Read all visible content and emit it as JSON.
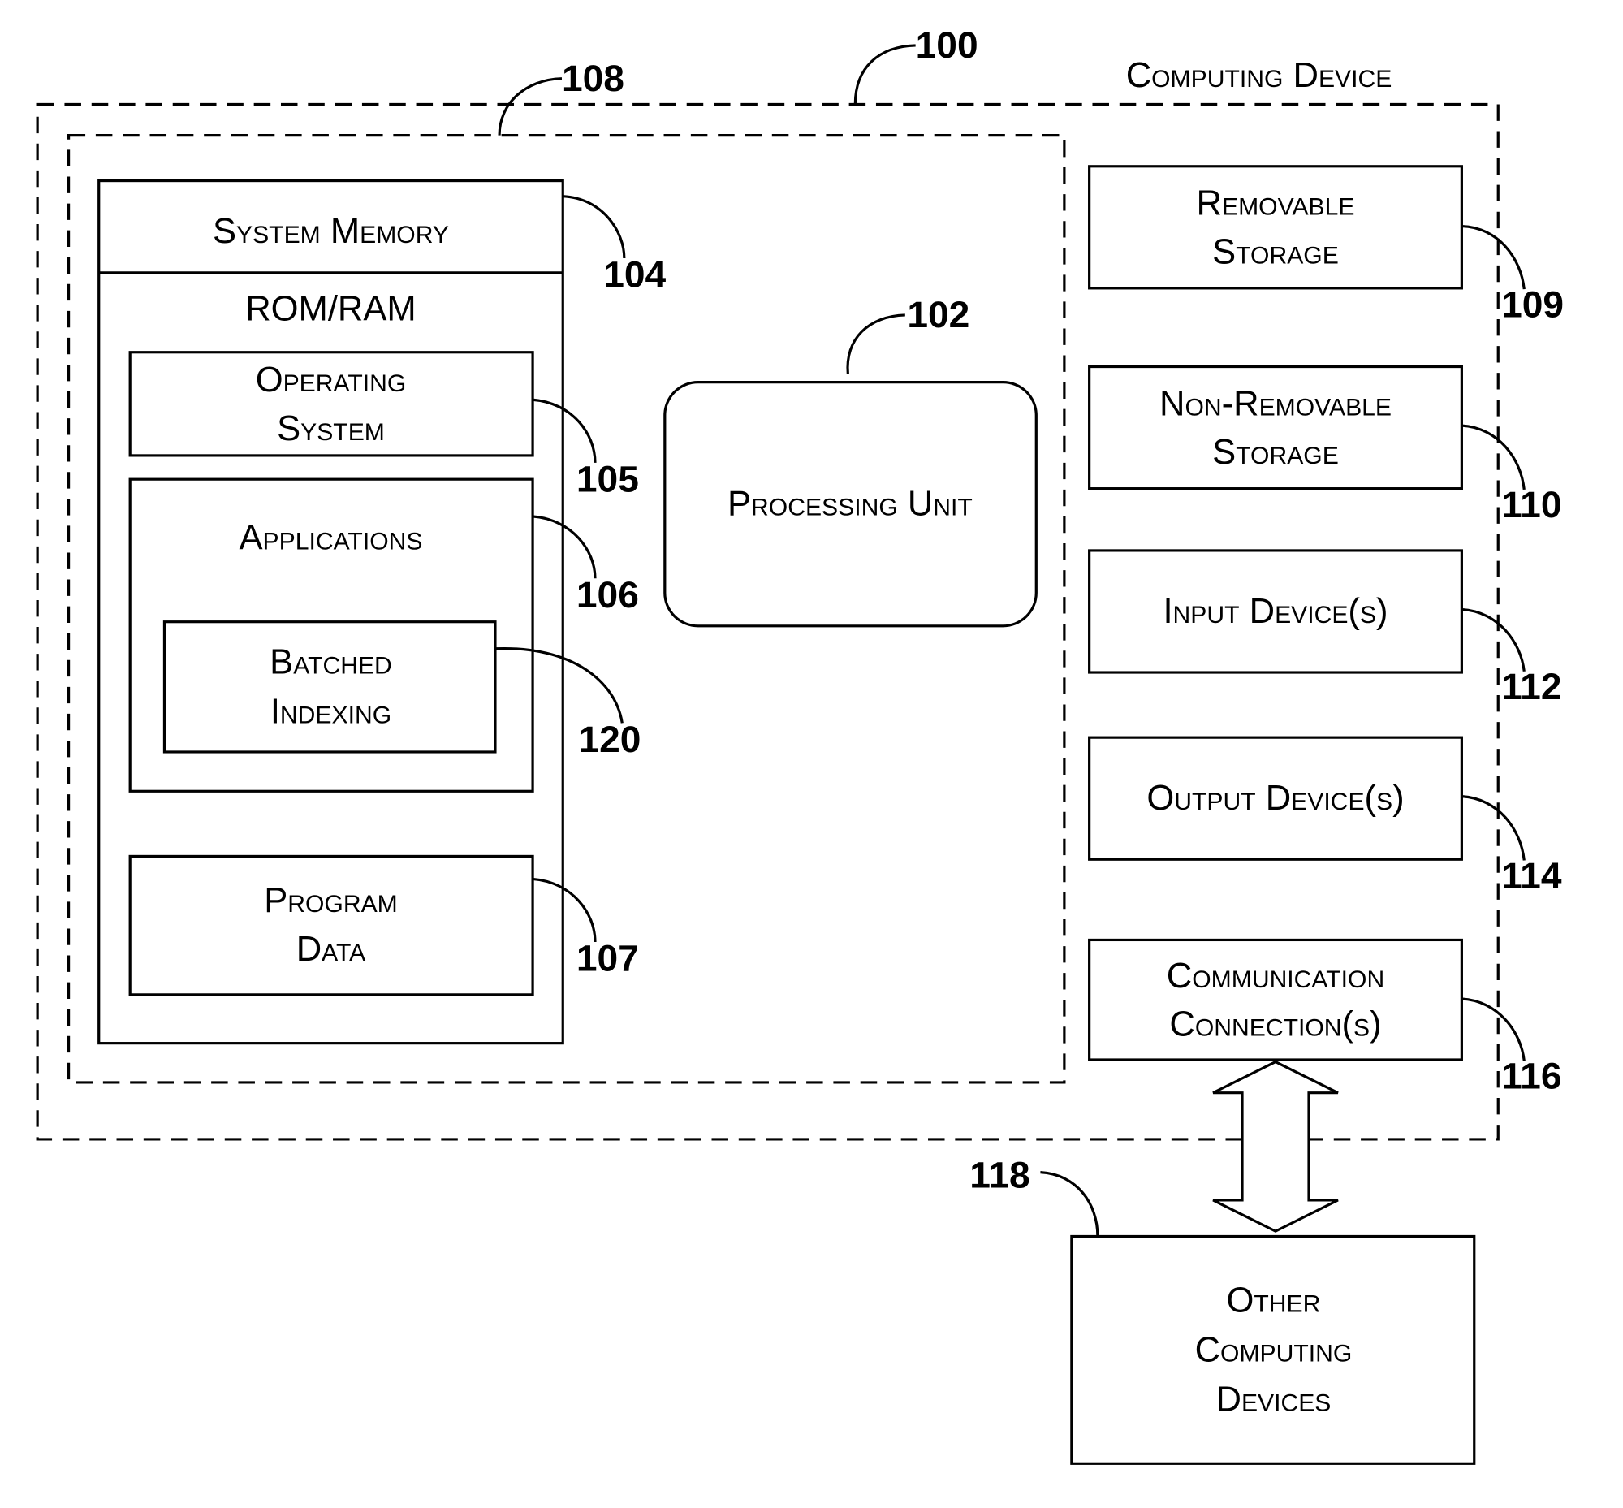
{
  "diagram": {
    "title": "Computing Device",
    "components": {
      "computing_device": {
        "label": "Computing Device",
        "ref": "100"
      },
      "core": {
        "ref": "108"
      },
      "system_memory": {
        "label": "System Memory",
        "ref": "104",
        "sublabel": "ROM/RAM"
      },
      "operating_system": {
        "line1": "Operating",
        "line2": "System",
        "ref": "105"
      },
      "applications": {
        "label": "Applications",
        "ref": "106"
      },
      "batched_indexing": {
        "line1": "Batched",
        "line2": "Indexing",
        "ref": "120"
      },
      "program_data": {
        "line1": "Program",
        "line2": "Data",
        "ref": "107"
      },
      "processing_unit": {
        "label": "Processing Unit",
        "ref": "102"
      },
      "removable_storage": {
        "line1": "Removable",
        "line2": "Storage",
        "ref": "109"
      },
      "non_removable_storage": {
        "line1": "Non-Removable",
        "line2": "Storage",
        "ref": "110"
      },
      "input_devices": {
        "label": "Input Device(s)",
        "ref": "112"
      },
      "output_devices": {
        "label": "Output Device(s)",
        "ref": "114"
      },
      "communication_connections": {
        "line1": "Communication",
        "line2": "Connection(s)",
        "ref": "116"
      },
      "other_computing_devices": {
        "line1": "Other",
        "line2": "Computing",
        "line3": "Devices",
        "ref": "118"
      }
    },
    "connections": [
      {
        "from": "communication_connections",
        "to": "other_computing_devices",
        "type": "bidirectional-arrow"
      }
    ]
  }
}
